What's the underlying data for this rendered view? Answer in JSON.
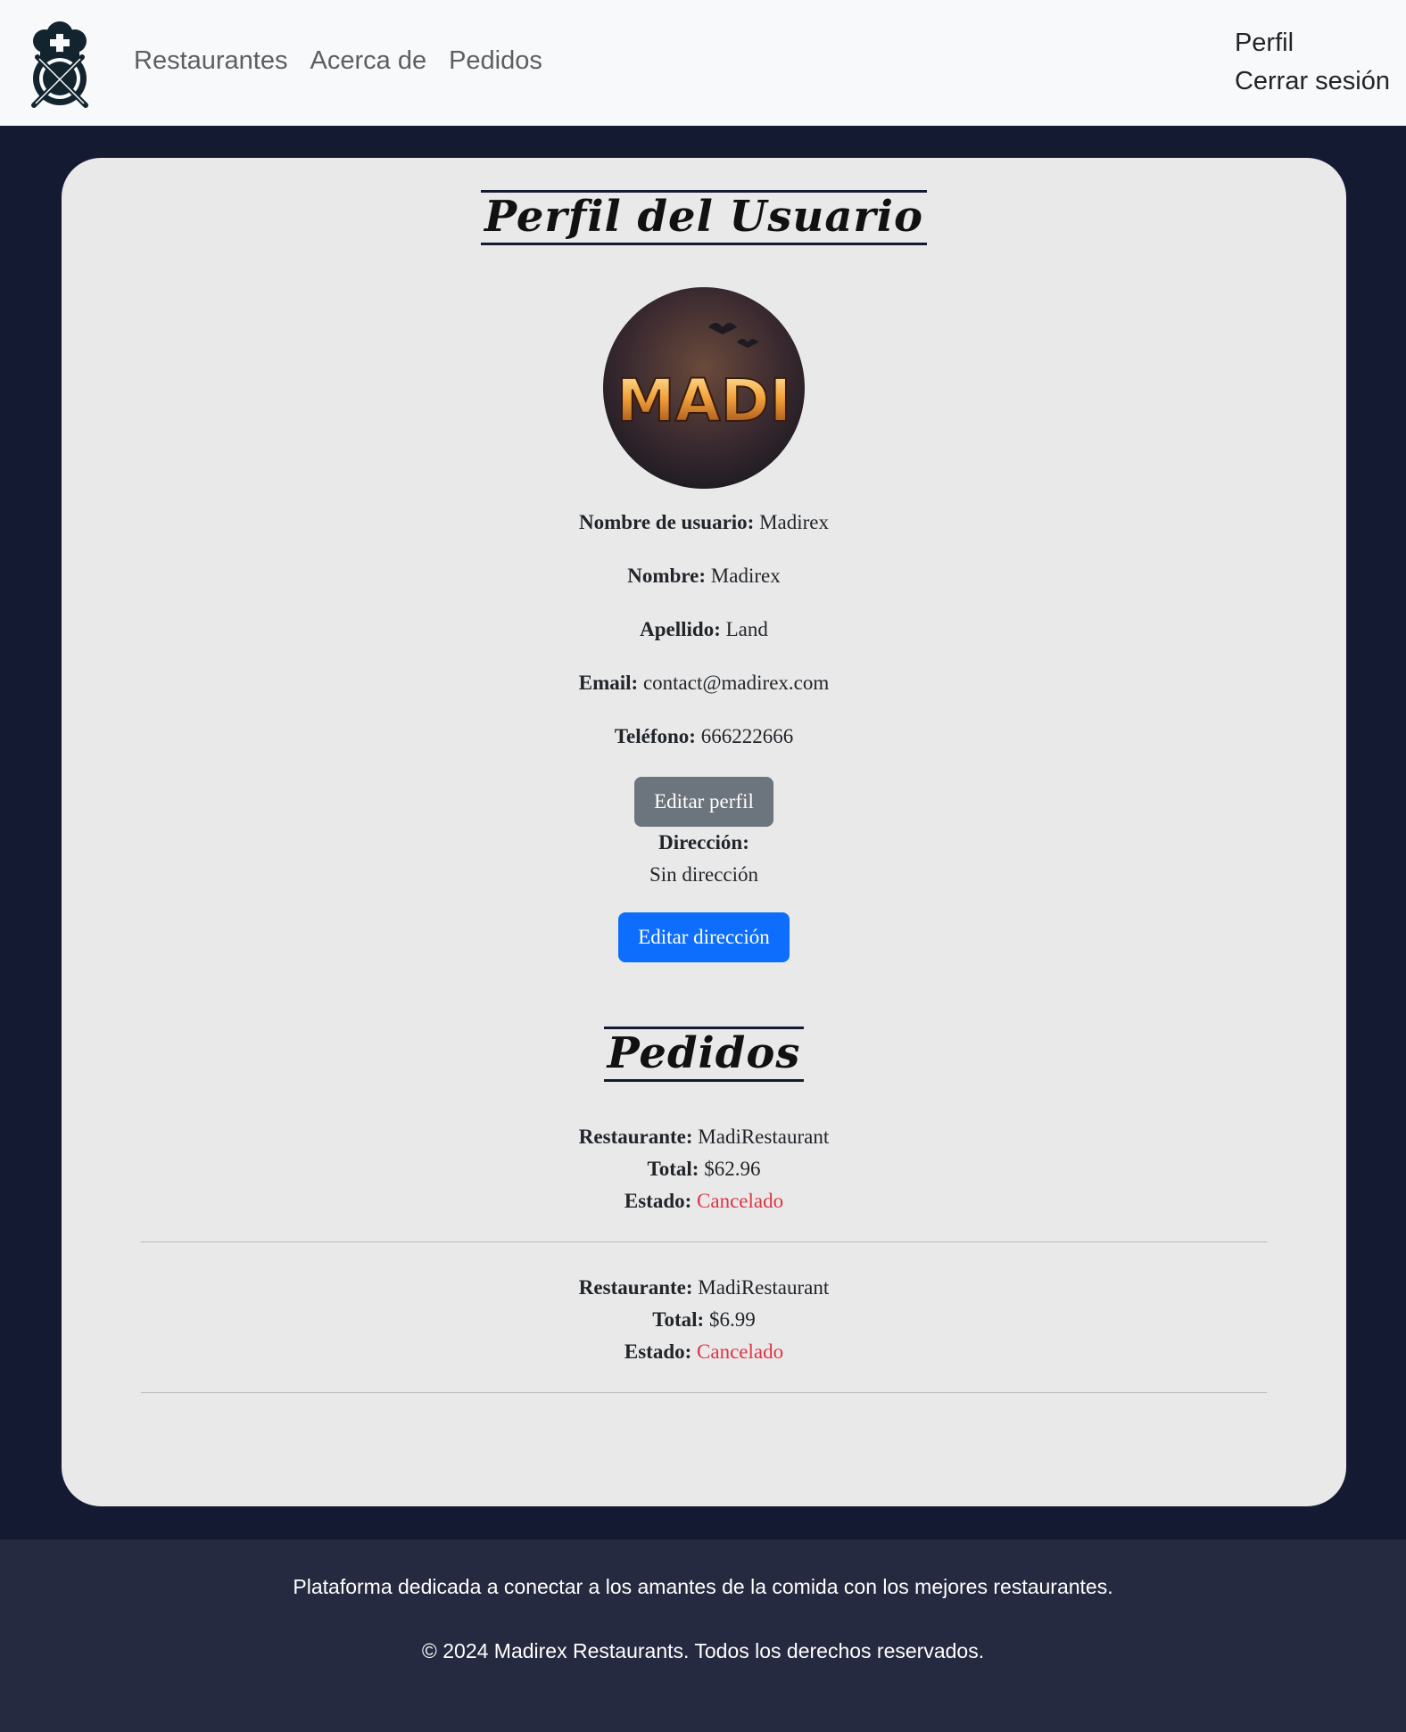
{
  "nav": {
    "links": [
      "Restaurantes",
      "Acerca de",
      "Pedidos"
    ],
    "right": [
      "Perfil",
      "Cerrar sesión"
    ]
  },
  "profile": {
    "title": "Perfil del Usuario",
    "avatar_text": "MADI",
    "fields": [
      {
        "label": "Nombre de usuario:",
        "value": "Madirex"
      },
      {
        "label": "Nombre:",
        "value": "Madirex"
      },
      {
        "label": "Apellido:",
        "value": "Land"
      },
      {
        "label": "Email:",
        "value": "contact@madirex.com"
      },
      {
        "label": "Teléfono:",
        "value": "666222666"
      }
    ],
    "edit_profile_label": "Editar perfil",
    "address_label": "Dirección:",
    "address_value": "Sin dirección",
    "edit_address_label": "Editar dirección"
  },
  "orders": {
    "title": "Pedidos",
    "labels": {
      "restaurant": "Restaurante:",
      "total": "Total:",
      "status": "Estado:"
    },
    "items": [
      {
        "restaurant": "MadiRestaurant",
        "total": "$62.96",
        "status": "Cancelado"
      },
      {
        "restaurant": "MadiRestaurant",
        "total": "$6.99",
        "status": "Cancelado"
      }
    ]
  },
  "footer": {
    "tagline": "Plataforma dedicada a conectar a los amantes de la comida con los mejores restaurantes.",
    "copyright": "© 2024 Madirex Restaurants. Todos los derechos reservados."
  },
  "colors": {
    "page_bg": "#151a33",
    "card_bg": "#e9e9ea",
    "status_cancelled": "#dc3545",
    "primary": "#0d6efd",
    "secondary": "#6c757d",
    "footer_bg": "#252a41"
  }
}
